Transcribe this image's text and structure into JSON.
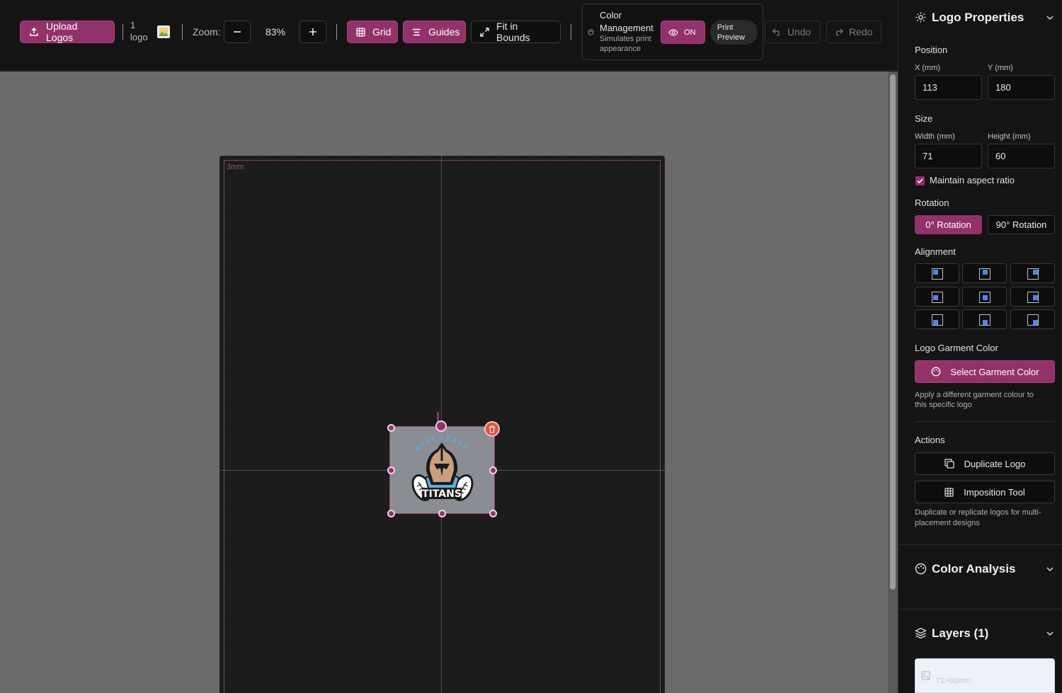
{
  "toolbar": {
    "upload_label": "Upload Logos",
    "logo_count_num": "1",
    "logo_count_word": "logo",
    "zoom_label": "Zoom:",
    "zoom_value": "83%",
    "grid_label": "Grid",
    "guides_label": "Guides",
    "fit_label": "Fit in Bounds",
    "undo_label": "Undo",
    "redo_label": "Redo"
  },
  "color_management": {
    "title_line1": "Color",
    "title_line2": "Management",
    "subtitle_line1": "Simulates print",
    "subtitle_line2": "appearance",
    "toggle_label": "ON",
    "preview_line1": "Print",
    "preview_line2": "Preview"
  },
  "canvas": {
    "bleed_label": "3mm",
    "logo_text": "TITANS",
    "logo_arc_text": "EAST COAST"
  },
  "properties": {
    "title": "Logo Properties",
    "position_label": "Position",
    "x_label": "X (mm)",
    "x_value": "113",
    "y_label": "Y (mm)",
    "y_value": "180",
    "size_label": "Size",
    "width_label": "Width (mm)",
    "width_value": "71",
    "height_label": "Height (mm)",
    "height_value": "60",
    "aspect_label": "Maintain aspect ratio",
    "aspect_checked": true,
    "rotation_label": "Rotation",
    "rotation_0": "0° Rotation",
    "rotation_90": "90° Rotation",
    "alignment_label": "Alignment",
    "garment_label": "Logo Garment Color",
    "garment_button": "Select Garment Color",
    "garment_help_line1": "Apply a different garment colour to",
    "garment_help_line2": "this specific logo",
    "actions_label": "Actions",
    "duplicate_label": "Duplicate Logo",
    "imposition_label": "Imposition Tool",
    "actions_help_line1": "Duplicate or replicate logos for multi-",
    "actions_help_line2": "placement designs"
  },
  "color_analysis": {
    "title": "Color Analysis"
  },
  "layers": {
    "title": "Layers (1)",
    "item_size": "71×60mm"
  },
  "colors": {
    "accent": "#93326a",
    "delete": "#e0523c",
    "align_dot": "#4f84f0"
  }
}
